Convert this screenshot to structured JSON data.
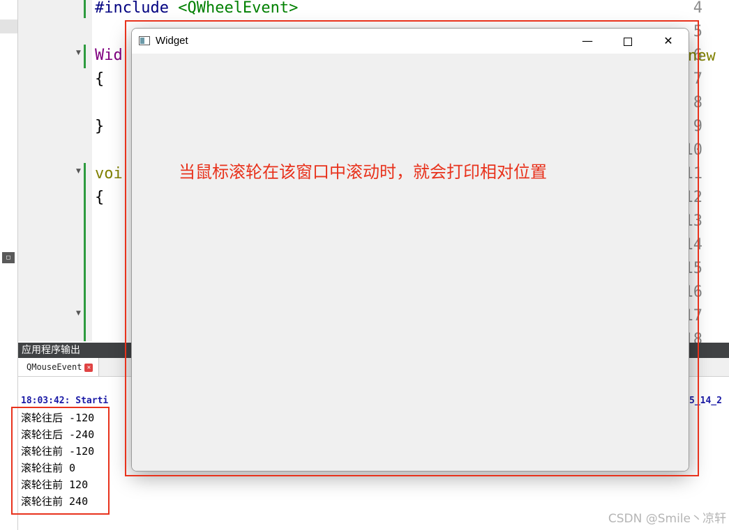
{
  "editor": {
    "line_numbers": [
      "4",
      "5",
      "6",
      "7",
      "8",
      "9",
      "10",
      "11",
      "12",
      "13",
      "14",
      "15",
      "16",
      "17",
      "18"
    ],
    "code": {
      "line4_keyword": "#include",
      "line4_header": "<QWheelEvent>",
      "line6": "Wid",
      "line6_right": "new",
      "line7": "{",
      "line9": "}",
      "line11": "voi",
      "line12": "{"
    },
    "strip_button": "□"
  },
  "output_pane": {
    "header": "应用程序输出",
    "tab_label": "QMouseEvent",
    "tab_close": "✕",
    "start_text": "18:03:42: Starti",
    "start_text_right": "5_14_2",
    "rows": [
      "滚轮往后 -120",
      "滚轮往后 -240",
      "滚轮往前 -120",
      "滚轮往前 0",
      "滚轮往前 120",
      "滚轮往前 240"
    ]
  },
  "window": {
    "title": "Widget",
    "icon": "app-window-icon",
    "minimize_glyph": "—",
    "close_glyph": "✕",
    "annotation": "当鼠标滚轮在该窗口中滚动时，就会打印相对位置"
  },
  "watermark": "CSDN @Smile丶凉轩",
  "colors": {
    "highlight": "#e8321c",
    "line_green": "#2e9b3f",
    "output_blue": "#1a1aa6"
  }
}
